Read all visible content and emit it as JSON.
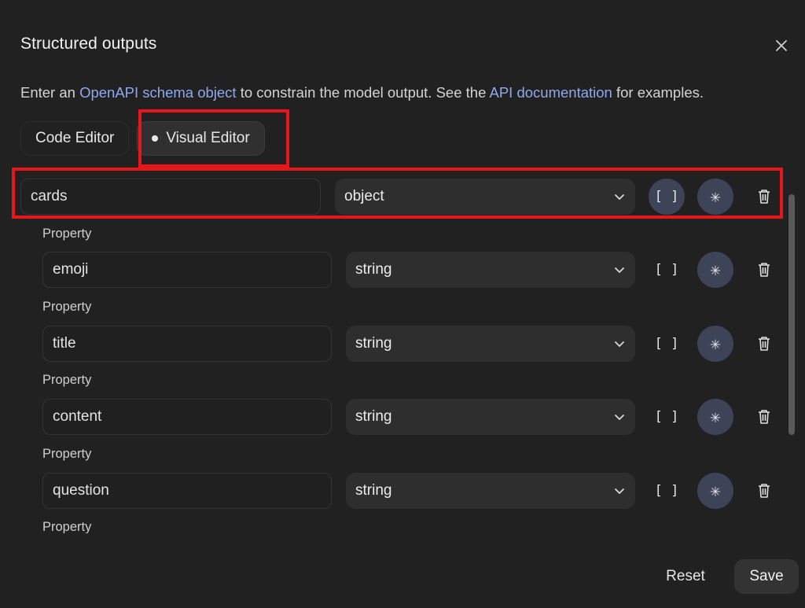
{
  "dialog": {
    "title": "Structured outputs",
    "close_icon": "close-icon"
  },
  "description": {
    "part1": "Enter an ",
    "link1": "OpenAPI schema object",
    "part2": " to constrain the model output. See the ",
    "link2": "API documentation",
    "part3": " for examples."
  },
  "tabs": [
    {
      "label": "Code Editor",
      "active": false
    },
    {
      "label": "Visual Editor",
      "active": true
    }
  ],
  "root": {
    "name": "cards",
    "type": "object",
    "array_glyph": "[ ]",
    "required_glyph": "✳"
  },
  "property_label": "Property",
  "properties": [
    {
      "name": "emoji",
      "type": "string"
    },
    {
      "name": "title",
      "type": "string"
    },
    {
      "name": "content",
      "type": "string"
    },
    {
      "name": "question",
      "type": "string"
    }
  ],
  "array_glyph": "[ ]",
  "required_glyph": "✳",
  "footer": {
    "reset_label": "Reset",
    "save_label": "Save"
  },
  "colors": {
    "background": "#212121",
    "link": "#8fa8f0",
    "highlight": "#e6161b",
    "required_button": "#3e4457"
  }
}
